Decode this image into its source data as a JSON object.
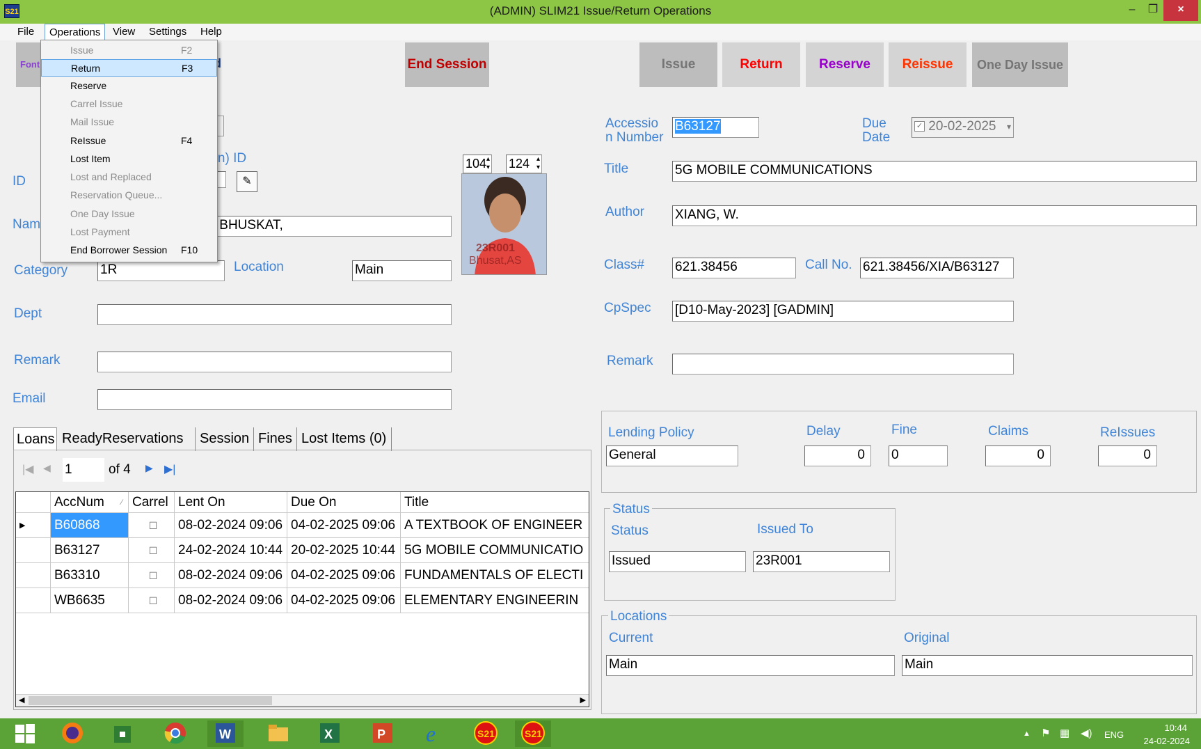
{
  "window": {
    "title": "(ADMIN) SLIM21 Issue/Return Operations",
    "icon_label": "S21",
    "close_glyph": "×",
    "minimize_glyph": "–",
    "restore_glyph": "❐"
  },
  "menubar": {
    "items": [
      "File",
      "Operations",
      "View",
      "Settings",
      "Help"
    ]
  },
  "operations_menu": [
    {
      "label": "Issue",
      "shortcut": "F2",
      "enabled": false
    },
    {
      "label": "Return",
      "shortcut": "F3",
      "enabled": true,
      "highlight": true
    },
    {
      "label": "Reserve",
      "shortcut": "",
      "enabled": true
    },
    {
      "label": "Carrel Issue",
      "shortcut": "",
      "enabled": false
    },
    {
      "label": "Mail Issue",
      "shortcut": "",
      "enabled": false
    },
    {
      "label": "ReIssue",
      "shortcut": "F4",
      "enabled": true
    },
    {
      "label": "Lost Item",
      "shortcut": "",
      "enabled": true
    },
    {
      "label": "Lost and Replaced",
      "shortcut": "",
      "enabled": false
    },
    {
      "label": "Reservation Queue...",
      "shortcut": "",
      "enabled": false
    },
    {
      "label": "One Day Issue",
      "shortcut": "",
      "enabled": false
    },
    {
      "label": "Lost Payment",
      "shortcut": "",
      "enabled": false
    },
    {
      "label": "End Borrower Session",
      "shortcut": "F10",
      "enabled": true
    }
  ],
  "toolbar": {
    "font_label": "Font",
    "board_label": "ard",
    "end_session": "End Session",
    "issue": "Issue",
    "return": "Return",
    "reserve": "Reserve",
    "reissue": "Reissue",
    "one_day_issue": "One Day Issue"
  },
  "colors": {
    "end_session": "#c00000",
    "return": "#ff0000",
    "reserve": "#9900cc",
    "reissue": "#ff3300",
    "issue": "#757575",
    "one_day_issue": "#757575",
    "label": "#3f84d6"
  },
  "patron": {
    "id_label_partial": "ron) ID",
    "id_label": "ID",
    "name_label": "Nam",
    "name_value": "U. BHUSKAT,",
    "category_label": "Category",
    "category_value": "1R",
    "location_label": "Location",
    "location_value": "Main",
    "dept_label": "Dept",
    "dept_value": "",
    "remark_label": "Remark",
    "remark_value": "",
    "email_label": "Email",
    "email_value": "",
    "photo_w": "104",
    "photo_h": "124",
    "photo_caption": "23R001",
    "photo_caption2": "Bhusat,AS"
  },
  "item": {
    "accession_label": "Accessio\nn Number",
    "accession_value": "B63127",
    "due_label": "Due\nDate",
    "due_value": "20-02-2025",
    "title_label": "Title",
    "title_value": "5G MOBILE COMMUNICATIONS",
    "author_label": "Author",
    "author_value": "XIANG, W.",
    "class_label": "Class#",
    "class_value": "621.38456",
    "callno_label": "Call No.",
    "callno_value": "621.38456/XIA/B63127",
    "cpspec_label": "CpSpec",
    "cpspec_value": "[D10-May-2023] [GADMIN]",
    "remark_label": "Remark",
    "remark_value": ""
  },
  "policy": {
    "lending_label": "Lending Policy",
    "lending_value": "General",
    "delay_label": "Delay",
    "delay_value": "0",
    "fine_label": "Fine",
    "fine_value": "0",
    "claims_label": "Claims",
    "claims_value": "0",
    "reissues_label": "ReIssues",
    "reissues_value": "0"
  },
  "status": {
    "group_label": "Status",
    "status_label": "Status",
    "status_value": "Issued",
    "issued_to_label": "Issued To",
    "issued_to_value": "23R001"
  },
  "locations": {
    "group_label": "Locations",
    "current_label": "Current",
    "current_value": "Main",
    "original_label": "Original",
    "original_value": "Main"
  },
  "tabs": [
    "Loans",
    "ReadyReservations",
    "Session",
    "Fines",
    "Lost Items (0)"
  ],
  "pager": {
    "page": "1",
    "of": "of 4"
  },
  "loans": {
    "columns": [
      "AccNum",
      "Carrel",
      "Lent On",
      "Due On",
      "Title"
    ],
    "rows": [
      {
        "acc": "B60868",
        "carrel": "☐",
        "lent": "08-02-2024 09:06",
        "due": "04-02-2025 09:06",
        "title": "A TEXTBOOK OF ENGINEER"
      },
      {
        "acc": "B63127",
        "carrel": "☐",
        "lent": "24-02-2024 10:44",
        "due": "20-02-2025 10:44",
        "title": "5G MOBILE COMMUNICATIO"
      },
      {
        "acc": "B63310",
        "carrel": "☐",
        "lent": "08-02-2024 09:06",
        "due": "04-02-2025 09:06",
        "title": "FUNDAMENTALS OF ELECTI"
      },
      {
        "acc": "WB6635",
        "carrel": "☐",
        "lent": "08-02-2024 09:06",
        "due": "04-02-2025 09:06",
        "title": "ELEMENTARY ENGINEERIN"
      }
    ]
  },
  "taskbar": {
    "lang": "ENG",
    "time": "10:44",
    "date": "24-02-2024",
    "apps": [
      "windows-start-icon",
      "firefox-icon",
      "store-icon",
      "chrome-icon",
      "word-icon",
      "file-explorer-icon",
      "excel-icon",
      "powerpoint-icon",
      "internet-explorer-icon",
      "slim21-icon",
      "slim21-icon-2"
    ]
  }
}
